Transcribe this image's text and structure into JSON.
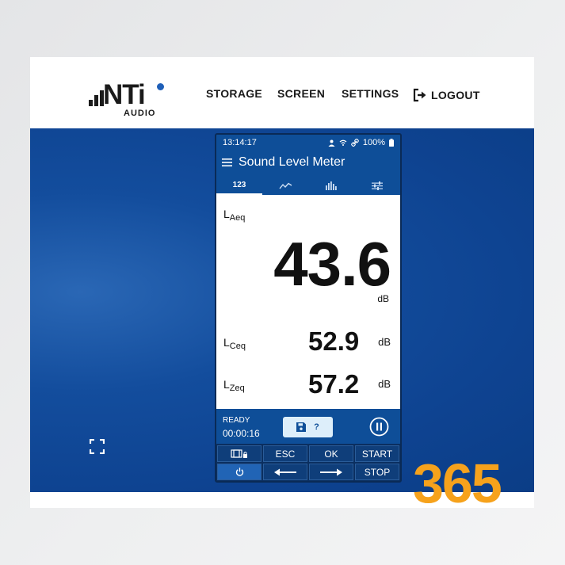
{
  "brand": {
    "name": "NTi",
    "subtitle": "AUDIO"
  },
  "nav": {
    "storage": "STORAGE",
    "screen": "SCREEN",
    "settings": "SETTINGS",
    "logout": "LOGOUT"
  },
  "device": {
    "status": {
      "time": "13:14:17",
      "battery": "100%"
    },
    "title": "Sound Level Meter",
    "tabs": [
      {
        "label": "123",
        "icon": "numeric-tab"
      },
      {
        "icon": "line-graph-icon"
      },
      {
        "icon": "spectrum-icon"
      },
      {
        "icon": "sliders-icon"
      }
    ],
    "readings": {
      "laeq": {
        "label_main": "L",
        "label_sub": "Aeq",
        "value": "43.6",
        "unit": "dB"
      },
      "lceq": {
        "label_main": "L",
        "label_sub": "Ceq",
        "value": "52.9",
        "unit": "dB"
      },
      "lzeq": {
        "label_main": "L",
        "label_sub": "Zeq",
        "value": "57.2",
        "unit": "dB"
      }
    },
    "footer": {
      "state": "READY",
      "elapsed": "00:00:16",
      "help": "?"
    },
    "keys": {
      "esc": "ESC",
      "ok": "OK",
      "start": "START",
      "stop": "STOP"
    }
  },
  "badge": "365",
  "colors": {
    "primary_blue": "#0e4e98",
    "accent_orange": "#f6a21c",
    "logo_dot": "#1f5fb8"
  }
}
